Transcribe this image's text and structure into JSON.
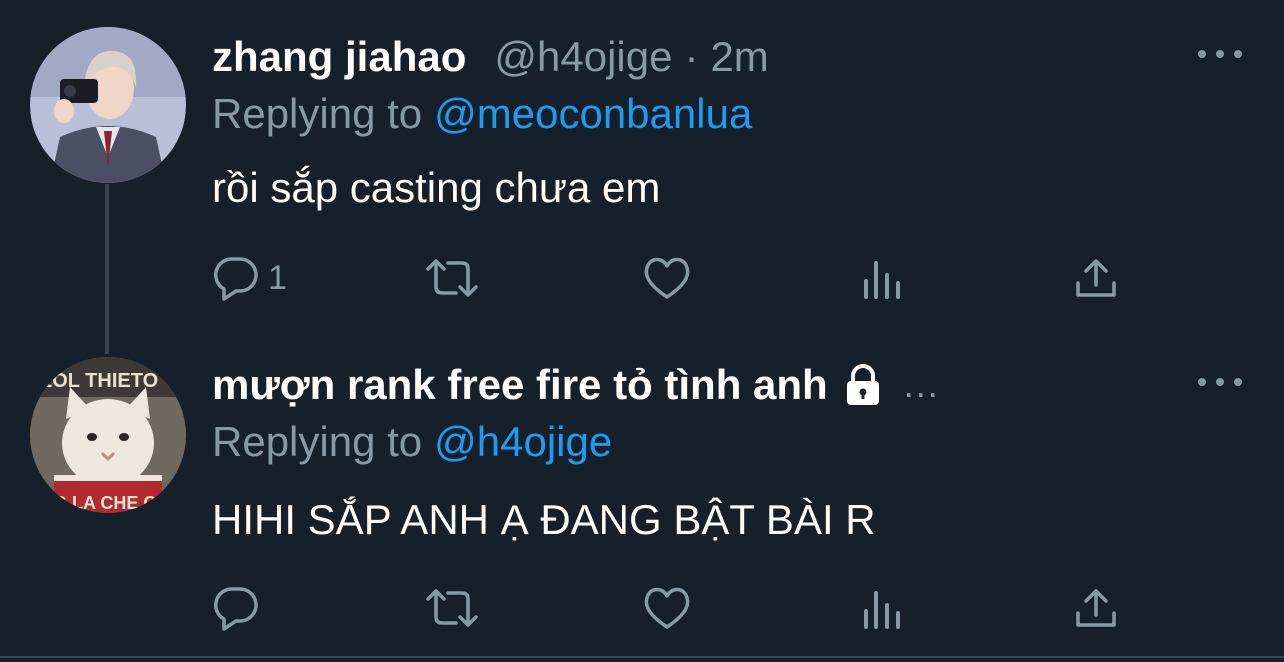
{
  "tweets": [
    {
      "name": "zhang jiahao",
      "handle": "@h4ojige",
      "separator": "·",
      "time": "2m",
      "replying_prefix": "Replying to",
      "replying_to": "@meoconbanlua",
      "text": "rồi sắp casting chưa em",
      "reply_count": "1",
      "protected": false,
      "truncated": false
    },
    {
      "name": "mượn rank free fire tỏ tình anh",
      "handle": "",
      "separator": "",
      "time": "",
      "truncated_marker": "...",
      "replying_prefix": "Replying to",
      "replying_to": "@h4ojige",
      "text": "HIHI SẮP ANH Ạ ĐANG BẬT BÀI R",
      "reply_count": "",
      "protected": true,
      "truncated": true
    }
  ],
  "icons": {
    "reply": "reply-icon",
    "retweet": "retweet-icon",
    "like": "heart-icon",
    "analytics": "analytics-icon",
    "share": "share-icon",
    "more": "more-icon",
    "lock": "lock-icon"
  },
  "colors": {
    "background": "#15202b",
    "text": "#ffffff",
    "secondary": "#8899a6",
    "accent": "#1d9bf0",
    "divider": "#38444d"
  }
}
